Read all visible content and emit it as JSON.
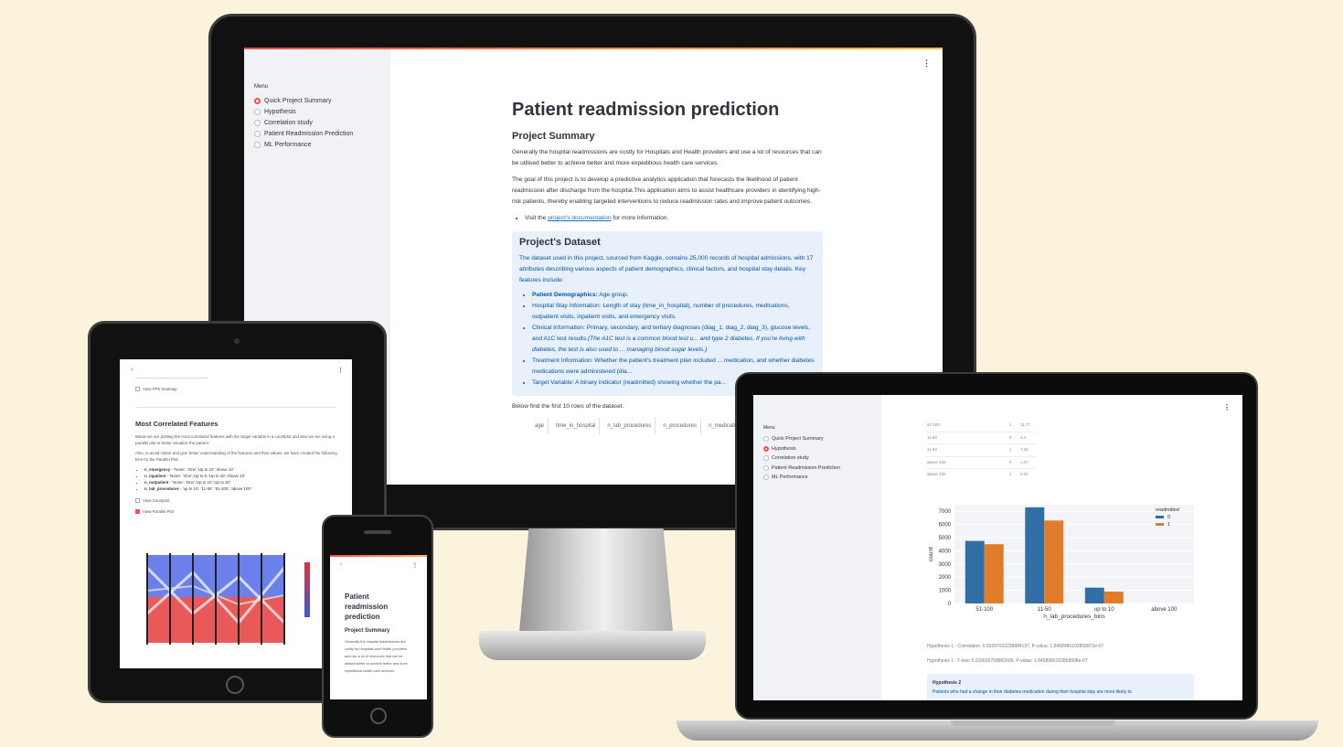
{
  "desktop": {
    "sidebar": {
      "menu_label": "Menu",
      "items": [
        {
          "label": "Quick Project Summary",
          "selected": true
        },
        {
          "label": "Hypothesis",
          "selected": false
        },
        {
          "label": "Correlation study",
          "selected": false
        },
        {
          "label": "Patient Readmission Prediction",
          "selected": false
        },
        {
          "label": "ML Performance",
          "selected": false
        }
      ]
    },
    "kebab": "⋮",
    "title": "Patient readmission prediction",
    "summary_heading": "Project Summary",
    "para1": "Generally the hospital readmissions are costly for Hospitals and Health providers and use a lot of resources that can be utilised better to achieve better and more expeditious health care services.",
    "para2": "The goal of this project is to develop a predictive analytics application that forecasts the likelihood of patient readmission after discharge from the hospital.This application aims to assist healthcare providers in identifying high-risk patients, thereby enabling targeted interventions to reduce readmission rates and improve patient outcomes.",
    "visit_prefix": "Visit the",
    "doc_link": "project's documentation",
    "visit_suffix": "for more information.",
    "dataset_heading": "Project's Dataset",
    "dataset_text": "The dataset used in this project, sourced from Kaggle, contains 25,000 records of hospital admissions, with 17 attributes describing various aspects of patient demographics, clinical factors, and hospital stay details. Key features include:",
    "features": [
      {
        "bold": "Patient Demographics:",
        "text": " Age group."
      },
      {
        "bold": "",
        "text": "Hospital Stay Information: Length of stay (time_in_hospital), number of procedures, medications, outpatient visits, inpatient visits, and emergency visits."
      },
      {
        "bold": "",
        "text": "Clinical Information: Primary, secondary, and tertiary diagnoses (diag_1, diag_2, diag_3), glucose levels, and A1C test results.",
        "italic": "(The A1C test is a common blood test u... and type 2 diabetes. If you're living with diabetes, the test is also used to ... managing blood sugar levels.)"
      },
      {
        "bold": "",
        "text": "Treatment Information: Whether the patient's treatment plan included ... medication, and whether diabetes medications were administered (dia..."
      },
      {
        "bold": "",
        "text": "Target Variable: A binary indicator (readmitted) showing whether the pa..."
      }
    ],
    "rows_caption": "Below find the first 10 rows of the dataset.",
    "table_headers": [
      "age",
      "time_in_hospital",
      "n_lab_procedures",
      "n_procedures",
      "n_medicati"
    ]
  },
  "tablet": {
    "expand": "›",
    "kebab": "⋮",
    "pps_checkbox": "View PPS heatmap",
    "heading": "Most Correlated Features",
    "para1": "Below we are plotting the most correlated features with the target variable in a countplot and also we are using a parallel plot to better visualize the pattern.",
    "para2": "Also, to avoid clutter and give better understanding of the features and their values, we have created the following bins for the Parallel Plot:",
    "bins": [
      {
        "name": "n_emergency",
        "text": " - 'None', 'One','Up to 10','Above 10'"
      },
      {
        "name": "n_inpatient",
        "text": " - 'None', 'One','Up to 5','Up to 10','Above 10'"
      },
      {
        "name": "n_outpatient",
        "text": " - 'None', 'One','Up to 10','Up to 20'"
      },
      {
        "name": "n_lab_procedures",
        "text": " - 'up to 10', '11-50', '51-100', 'above 100'"
      }
    ],
    "countplot_checkbox": "View Countplot",
    "parallel_checkbox": "View Parallel Plot"
  },
  "phone": {
    "expand": "›",
    "kebab": "⋮",
    "title": "Patient readmission prediction",
    "summary_heading": "Project Summary",
    "para": "Generally the hospital readmissions are costly for Hospitals and Health providers and use a lot of resources that can be utilised better to achieve better and more expeditious health care services."
  },
  "laptop": {
    "kebab": "⋮",
    "sidebar": {
      "menu_label": "Menu",
      "items": [
        {
          "label": "Quick Project Summary",
          "selected": false
        },
        {
          "label": "Hypothesis",
          "selected": true
        },
        {
          "label": "Correlation study",
          "selected": false
        },
        {
          "label": "Patient Readmission Prediction",
          "selected": false
        },
        {
          "label": "ML Performance",
          "selected": false
        }
      ]
    },
    "mini_table": [
      [
        "51-100",
        "1",
        "11.77"
      ],
      [
        "11-50",
        "0",
        "4.4"
      ],
      [
        "11-50",
        "1",
        "7.32"
      ],
      [
        "above 100",
        "0",
        "1.07"
      ],
      [
        "above 100",
        "1",
        "0.03"
      ]
    ],
    "hyp1_corr": "Hypothesis 1 - Correlation: 0.03297032238884197, P-value: 1.8458980102858973e-07",
    "hyp1_ttest": "Hypothesis 1 - T-test: 5.215692768862605, P-value: 1.8458980102858998e-07",
    "hyp2_title": "Hypothesis 2",
    "hyp2_text": "Patients who had a change in their diabetes medication during their hospital stay are more likely to"
  },
  "colors": {
    "accent": "#ff4b4b",
    "series0": "#2f6fa5",
    "series1": "#e17c2b",
    "info_bg": "#e8f0fb",
    "info_text": "#0054a3"
  },
  "chart_data": {
    "type": "bar",
    "categories": [
      "51-100",
      "11-50",
      "up to 10",
      "above 100"
    ],
    "series": [
      {
        "name": "0",
        "values": [
          4750,
          7300,
          1200,
          0
        ]
      },
      {
        "name": "1",
        "values": [
          4500,
          6300,
          900,
          0
        ]
      }
    ],
    "xlabel": "n_lab_procedures_bins",
    "ylabel": "count",
    "legend_title": "readmitted",
    "yticks": [
      0,
      1000,
      2000,
      3000,
      4000,
      5000,
      6000,
      7000
    ],
    "ylim": [
      0,
      7500
    ],
    "legend_position": "top-right",
    "grid": true
  }
}
